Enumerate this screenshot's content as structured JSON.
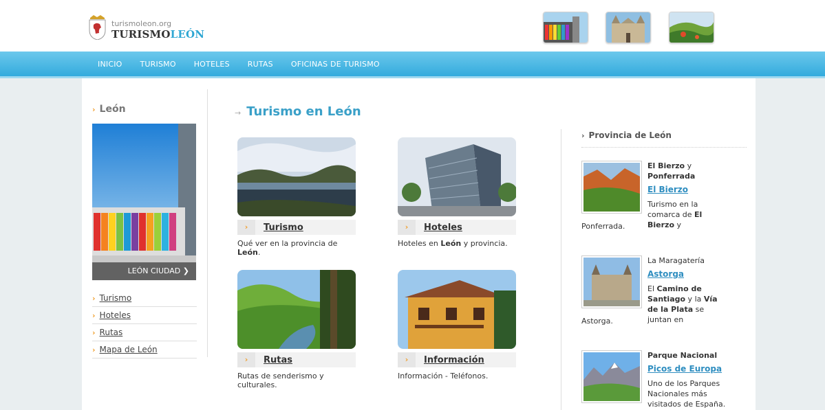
{
  "header": {
    "site_url": "turismoleon.org",
    "site_name_part1": "TURISMO",
    "site_name_part2": "LEÓN"
  },
  "nav": [
    "INICIO",
    "TURISMO",
    "HOTELES",
    "RUTAS",
    "OFICINAS DE TURISMO"
  ],
  "sidebar": {
    "title": "León",
    "image_caption": "LEÓN CIUDAD",
    "links": [
      "Turismo",
      "Hoteles",
      "Rutas",
      "Mapa de León"
    ]
  },
  "main": {
    "title": "Turismo en León",
    "cards": [
      {
        "label": "Turismo",
        "desc_pre": "Qué ver en la provincia de ",
        "desc_bold": "León",
        "desc_post": "."
      },
      {
        "label": "Hoteles",
        "desc_pre": "Hoteles en ",
        "desc_bold": "León",
        "desc_post": " y provincia."
      },
      {
        "label": "Rutas",
        "desc_pre": "Rutas de senderismo y culturales.",
        "desc_bold": "",
        "desc_post": ""
      },
      {
        "label": "Información",
        "desc_pre": "Información - Teléfonos.",
        "desc_bold": "",
        "desc_post": ""
      }
    ]
  },
  "right": {
    "title": "Provincia de León",
    "items": [
      {
        "head_bold": "El Bierzo",
        "head_rest": " y",
        "head_bold2": "Ponferrada",
        "link": "El Bierzo",
        "t1": "Turismo en la comarca de ",
        "t1b": "El Bierzo",
        "t1c": " y",
        "tail": "Ponferrada."
      },
      {
        "head": "La Maragatería",
        "link": "Astorga",
        "t1": "El ",
        "t1b": "Camino de Santiago",
        "t1c": " y la ",
        "t1d": "Vía de la Plata",
        "t1e": " se juntan en",
        "tail": "Astorga."
      },
      {
        "head_bold": "Parque Nacional",
        "link": "Picos de Europa",
        "t1": "Uno de los Parques Nacionales más visitados de España."
      }
    ]
  },
  "colors": {
    "accent": "#2fa7d3",
    "nav": "#33abdd",
    "arrow": "#f0a030",
    "link": "#2f8ec0"
  }
}
